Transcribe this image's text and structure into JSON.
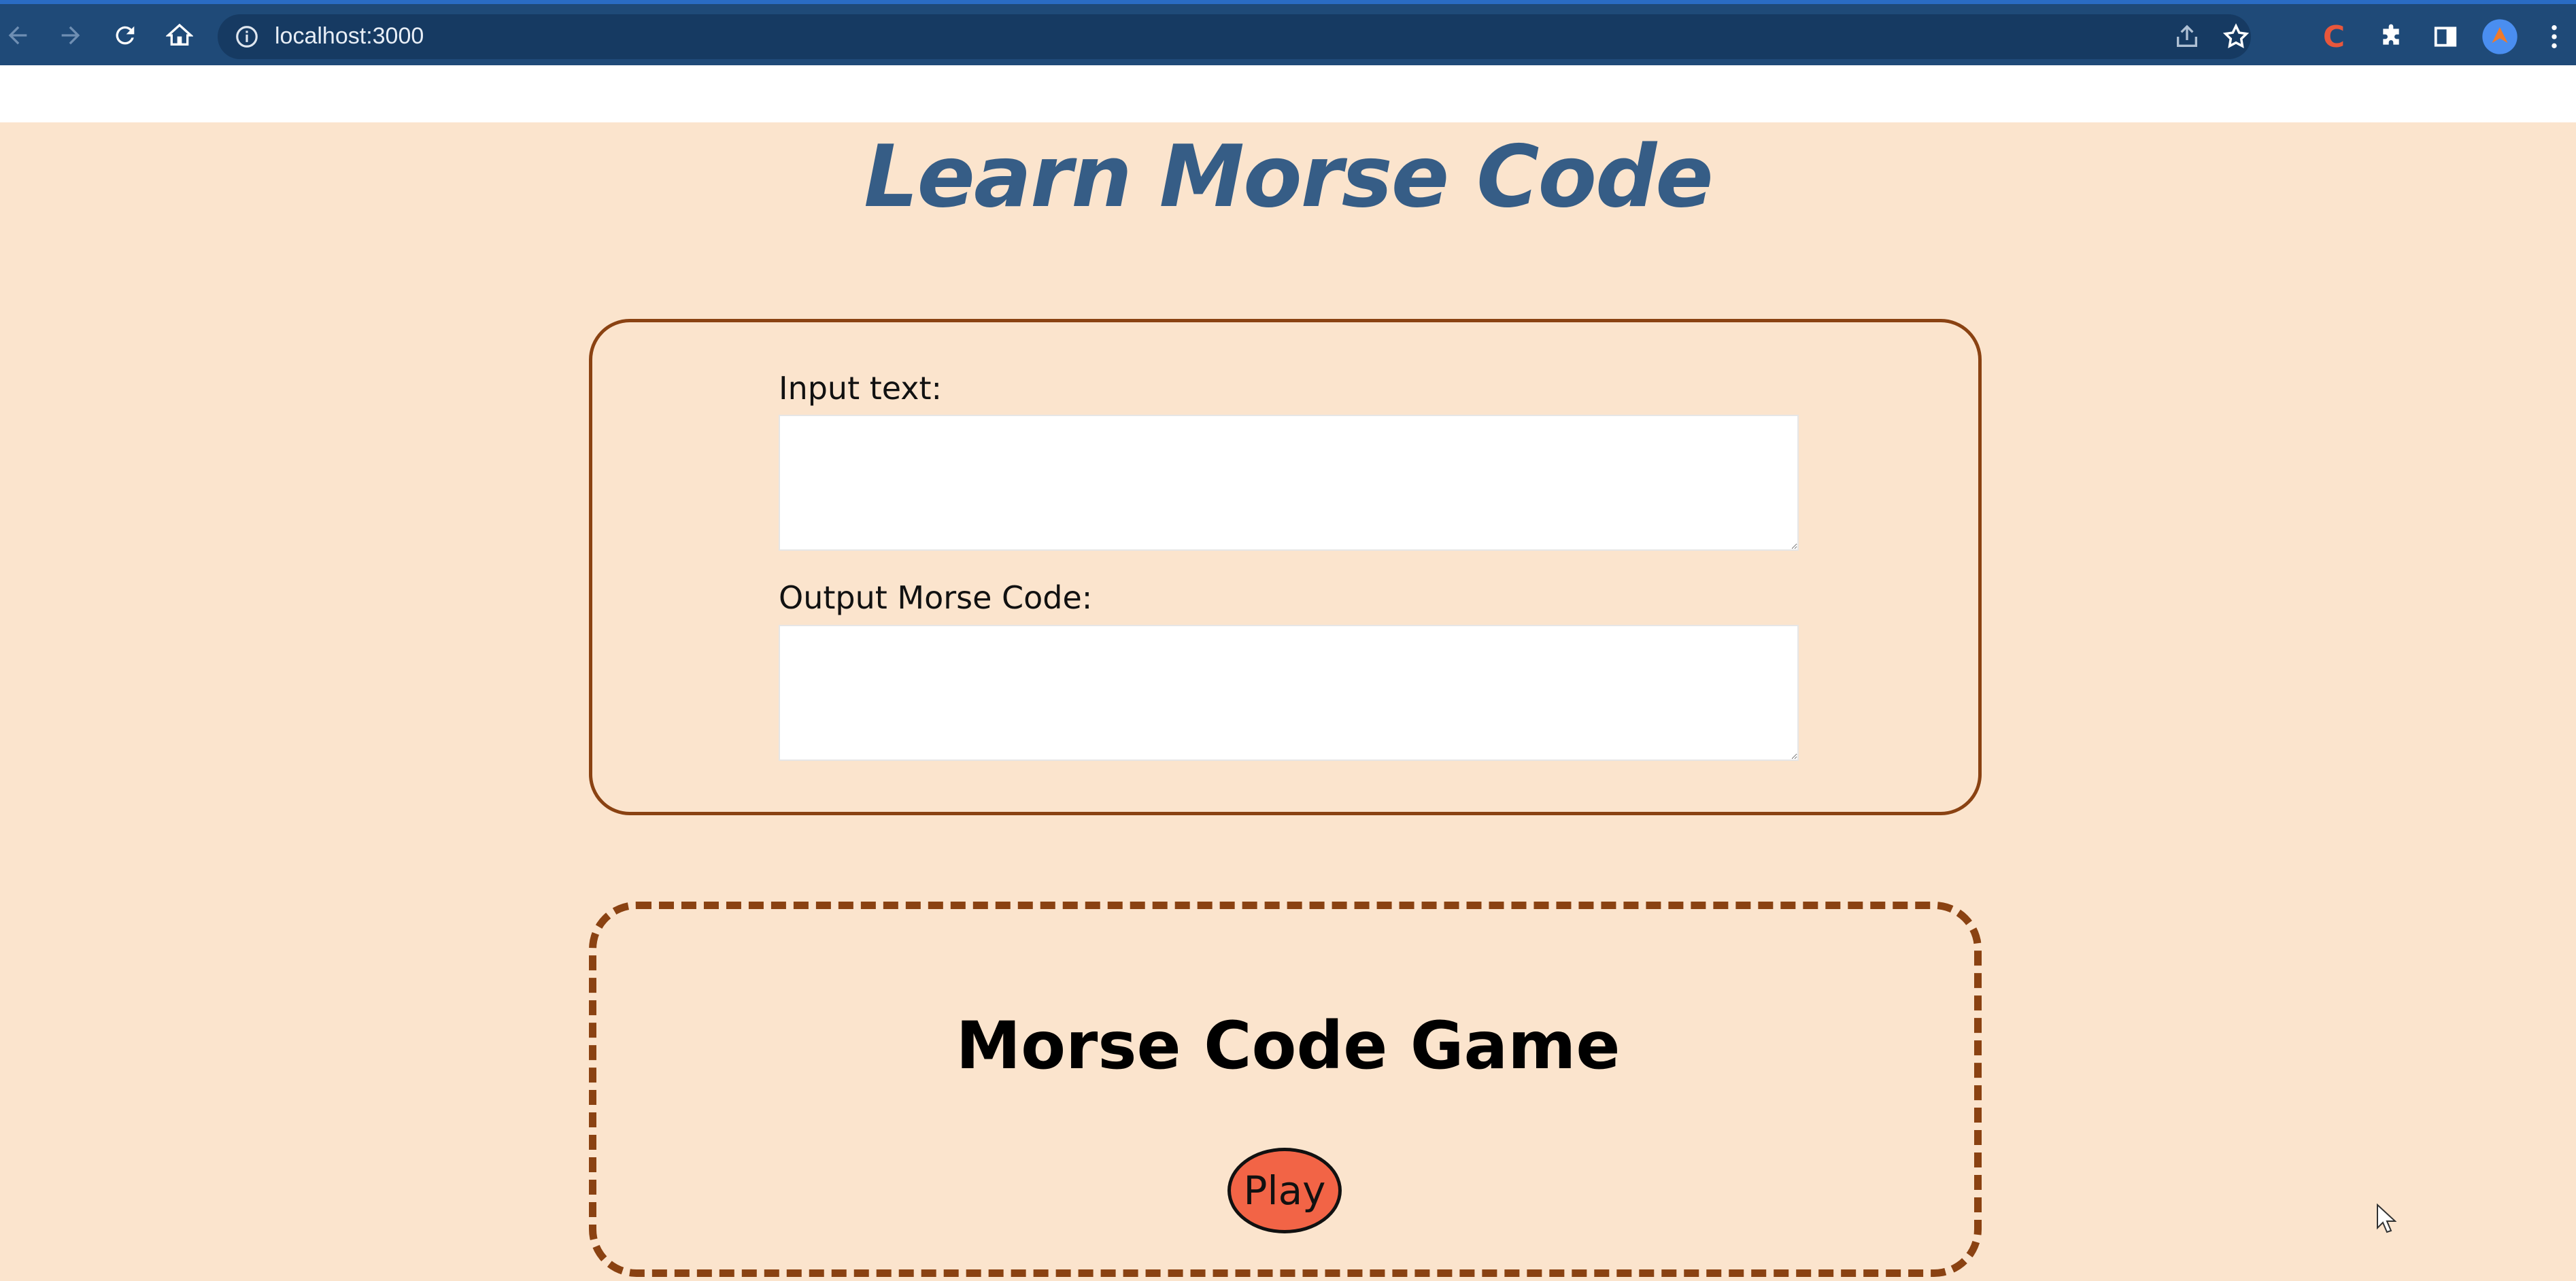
{
  "browser": {
    "url": "localhost:3000",
    "extension_letter": "C"
  },
  "page": {
    "title": "Learn Morse Code",
    "translator": {
      "input_label": "Input text:",
      "input_value": "",
      "output_label": "Output Morse Code:",
      "output_value": ""
    },
    "game": {
      "title": "Morse Code Game",
      "play_label": "Play"
    }
  },
  "colors": {
    "page_bg": "#fbe4cd",
    "title": "#365d86",
    "border": "#8a4212",
    "play_button": "#f26446",
    "browser_toolbar": "#1f4a78"
  },
  "icons": [
    "back-icon",
    "forward-icon",
    "reload-icon",
    "home-icon",
    "info-icon",
    "share-icon",
    "star-icon",
    "extension-c-icon",
    "puzzle-icon",
    "side-panel-icon",
    "profile-avatar",
    "kebab-menu-icon",
    "mouse-cursor"
  ]
}
